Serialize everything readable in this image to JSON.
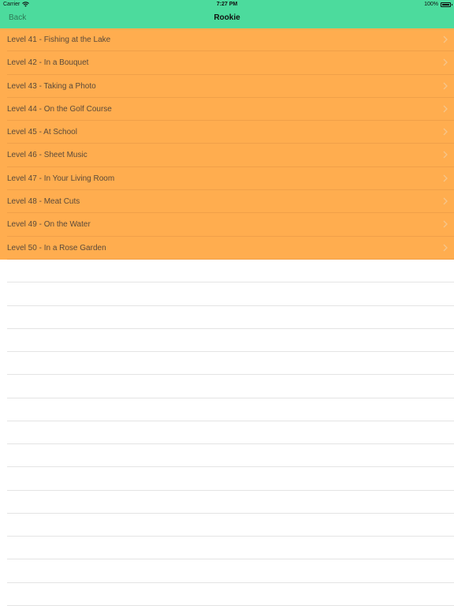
{
  "status_bar": {
    "carrier": "Carrier",
    "time": "7:27 PM",
    "battery_text": "100%",
    "battery_level": 1.0
  },
  "nav": {
    "back_label": "Back",
    "title": "Rookie"
  },
  "colors": {
    "navbar": "#4cdb9d",
    "row_background": "#ffad4f",
    "back_text": "#2e7a55"
  },
  "levels": [
    {
      "label": "Level 41 - Fishing at the Lake"
    },
    {
      "label": "Level 42 - In a Bouquet"
    },
    {
      "label": "Level 43 - Taking a Photo"
    },
    {
      "label": "Level 44 - On the Golf Course"
    },
    {
      "label": "Level 45 - At School"
    },
    {
      "label": "Level 46 - Sheet Music"
    },
    {
      "label": "Level 47 - In Your Living Room"
    },
    {
      "label": "Level 48 - Meat Cuts"
    },
    {
      "label": "Level 49 - On the Water"
    },
    {
      "label": "Level 50 - In a Rose Garden"
    }
  ]
}
